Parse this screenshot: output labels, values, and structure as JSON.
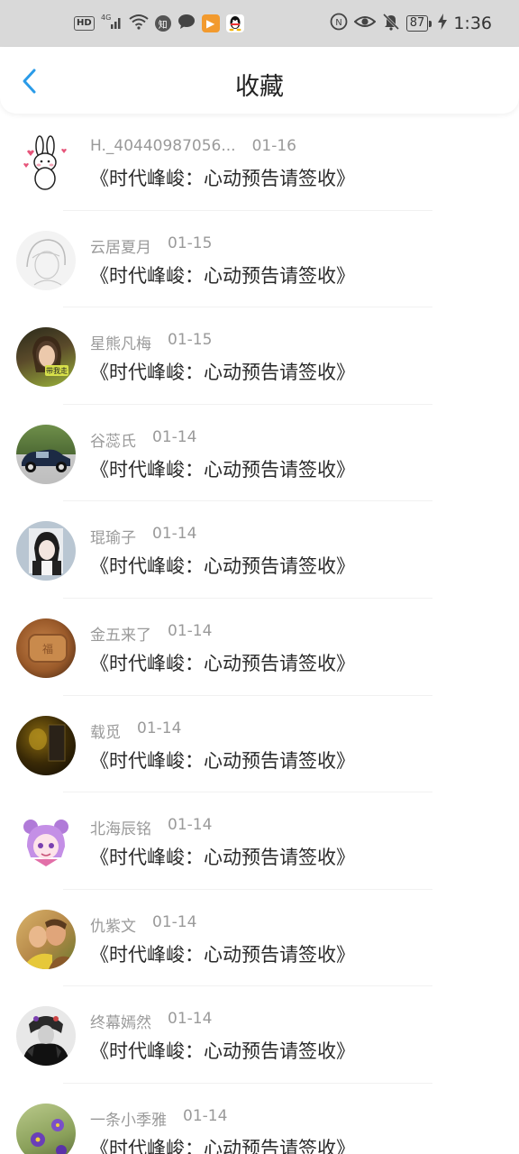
{
  "status_bar": {
    "hd": "HD",
    "net": "4G",
    "battery": "87",
    "time": "1:36",
    "icons": [
      "signal-icon",
      "wifi-icon",
      "zhihu-icon",
      "message-icon",
      "video-app-icon",
      "qq-icon",
      "nfc-icon",
      "eye-icon",
      "mute-icon",
      "charging-icon"
    ]
  },
  "header": {
    "title": "收藏"
  },
  "colors": {
    "accent": "#2a9be8",
    "meta_text": "#9a9a9a",
    "item_text": "#2a2a2a"
  },
  "favorites": [
    {
      "user": "H._40440987056...",
      "date": "01-16",
      "title": "《时代峰峻：心动预告请签收》",
      "avatar": "bunny-sticker"
    },
    {
      "user": "云居夏月",
      "date": "01-15",
      "title": "《时代峰峻：心动预告请签收》",
      "avatar": "sketch-portrait"
    },
    {
      "user": "星熊凡梅",
      "date": "01-15",
      "title": "《时代峰峻：心动预告请签收》",
      "avatar": "girl-portrait"
    },
    {
      "user": "谷蕊氏",
      "date": "01-14",
      "title": "《时代峰峻：心动预告请签收》",
      "avatar": "vintage-car"
    },
    {
      "user": "琨瑜子",
      "date": "01-14",
      "title": "《时代峰峻：心动预告请签收》",
      "avatar": "anime-girl"
    },
    {
      "user": "金五来了",
      "date": "01-14",
      "title": "《时代峰峻：心动预告请签收》",
      "avatar": "biscuit"
    },
    {
      "user": "载觅",
      "date": "01-14",
      "title": "《时代峰峻：心动预告请签收》",
      "avatar": "dark-room"
    },
    {
      "user": "北海辰铭",
      "date": "01-14",
      "title": "《时代峰峻：心动预告请签收》",
      "avatar": "purple-cartoon"
    },
    {
      "user": "仇紫文",
      "date": "01-14",
      "title": "《时代峰峻：心动预告请签收》",
      "avatar": "couple-photo"
    },
    {
      "user": "终幕嫣然",
      "date": "01-14",
      "title": "《时代峰峻：心动预告请签收》",
      "avatar": "dark-figure"
    },
    {
      "user": "一条小季雅",
      "date": "01-14",
      "title": "《时代峰峻：心动预告请签收》",
      "avatar": "flowers"
    }
  ]
}
